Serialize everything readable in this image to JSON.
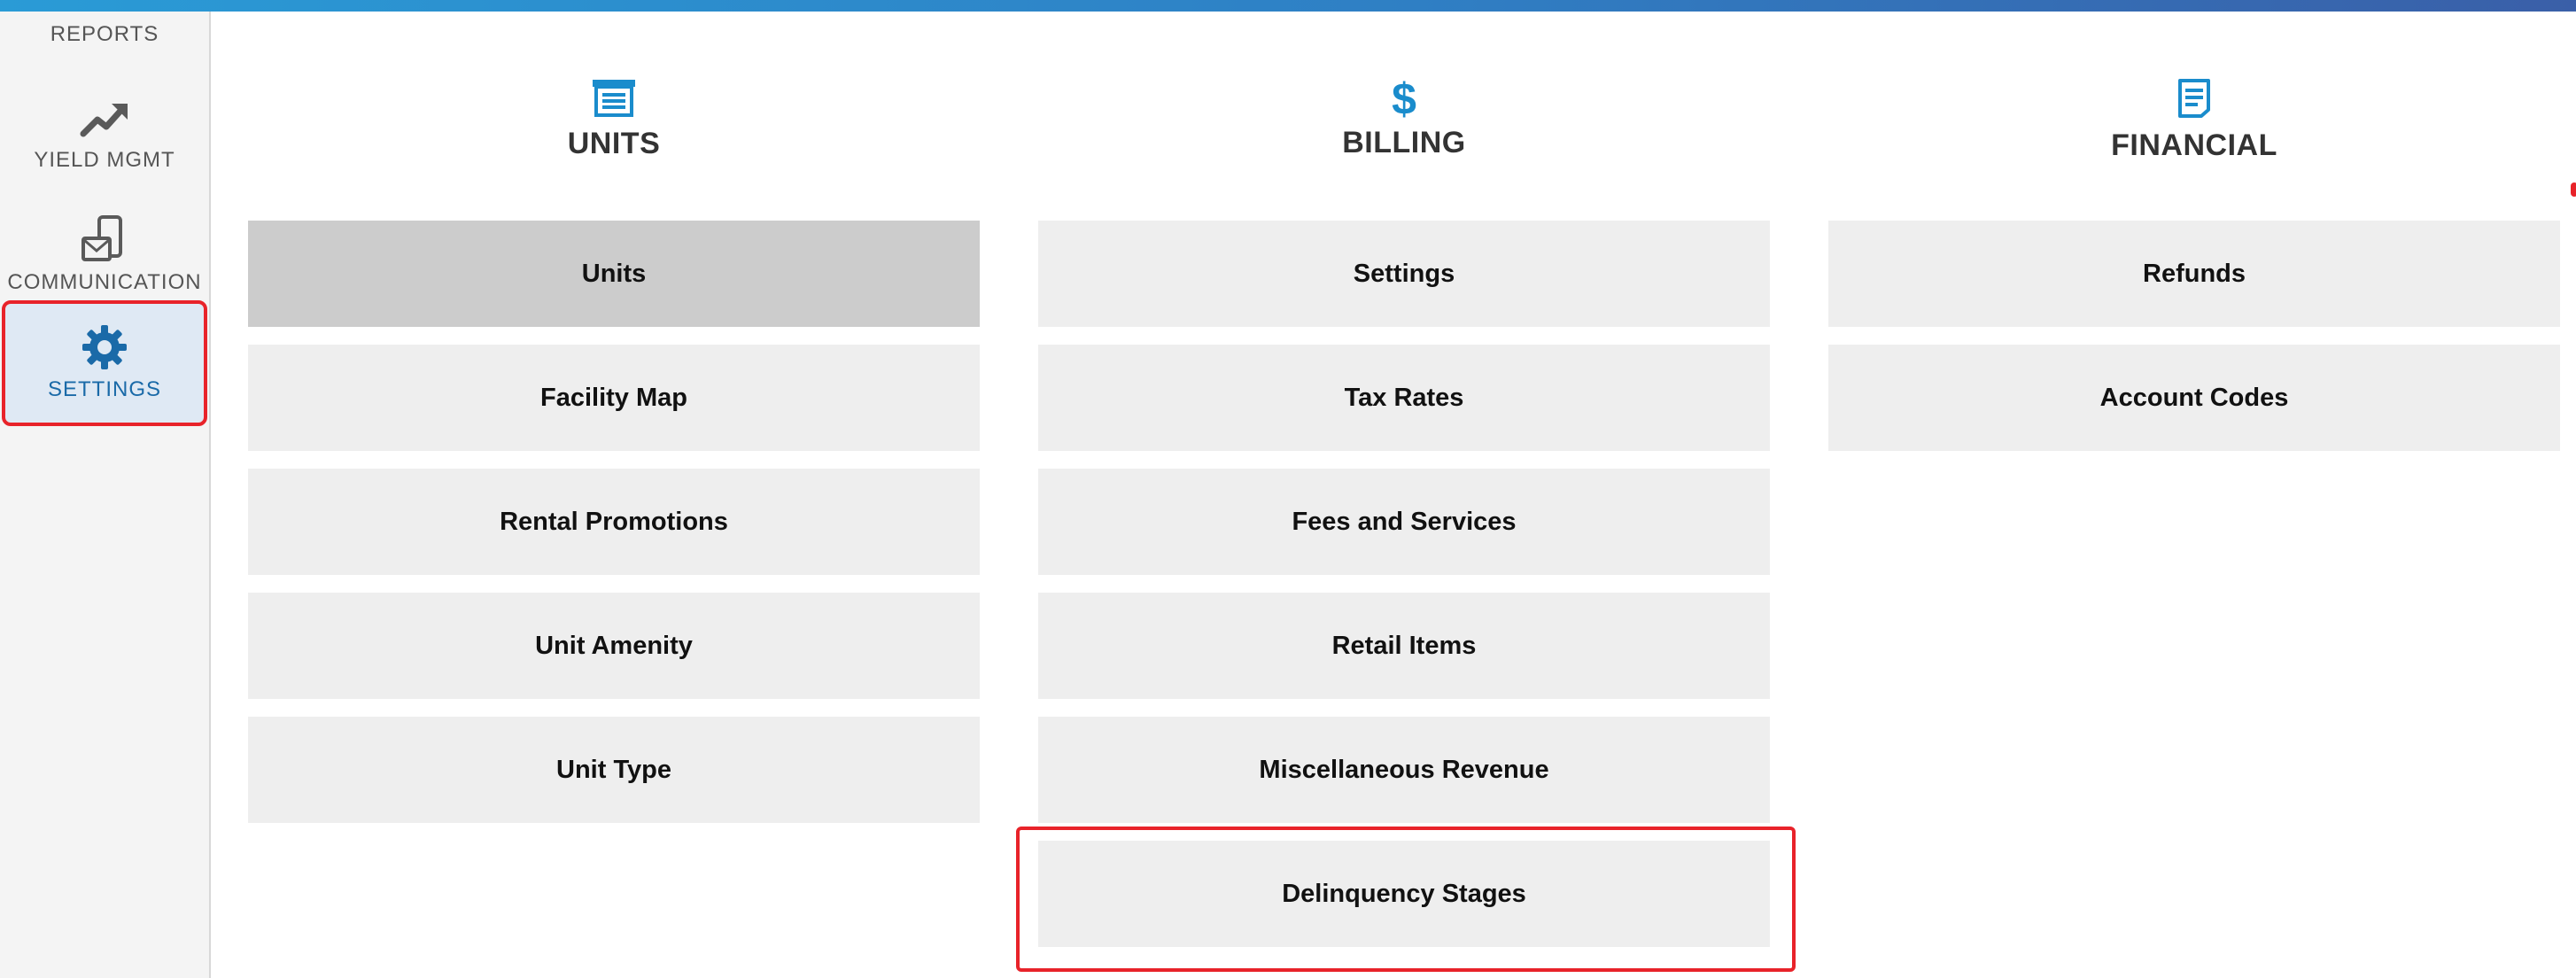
{
  "sidebar": {
    "items": [
      {
        "label": "REPORTS"
      },
      {
        "label": "YIELD MGMT",
        "icon": "trending-up-icon"
      },
      {
        "label": "COMMUNICATION",
        "icon": "phone-mail-icon"
      },
      {
        "label": "SETTINGS",
        "icon": "gear-icon",
        "active": true
      }
    ]
  },
  "columns": {
    "units": {
      "title": "UNITS",
      "icon": "storage-unit-icon",
      "items": [
        "Units",
        "Facility Map",
        "Rental Promotions",
        "Unit Amenity",
        "Unit Type"
      ]
    },
    "billing": {
      "title": "BILLING",
      "icon": "dollar-icon",
      "items": [
        "Settings",
        "Tax Rates",
        "Fees and Services",
        "Retail Items",
        "Miscellaneous Revenue",
        "Delinquency Stages"
      ]
    },
    "financial": {
      "title": "FINANCIAL",
      "icon": "document-icon",
      "items": [
        "Refunds",
        "Account Codes"
      ]
    }
  },
  "colors": {
    "accent": "#1a8ccc",
    "active_nav": "#1a6aa8",
    "highlight": "#e8232a",
    "tile": "#eeeeee",
    "tile_active": "#cccccc"
  }
}
